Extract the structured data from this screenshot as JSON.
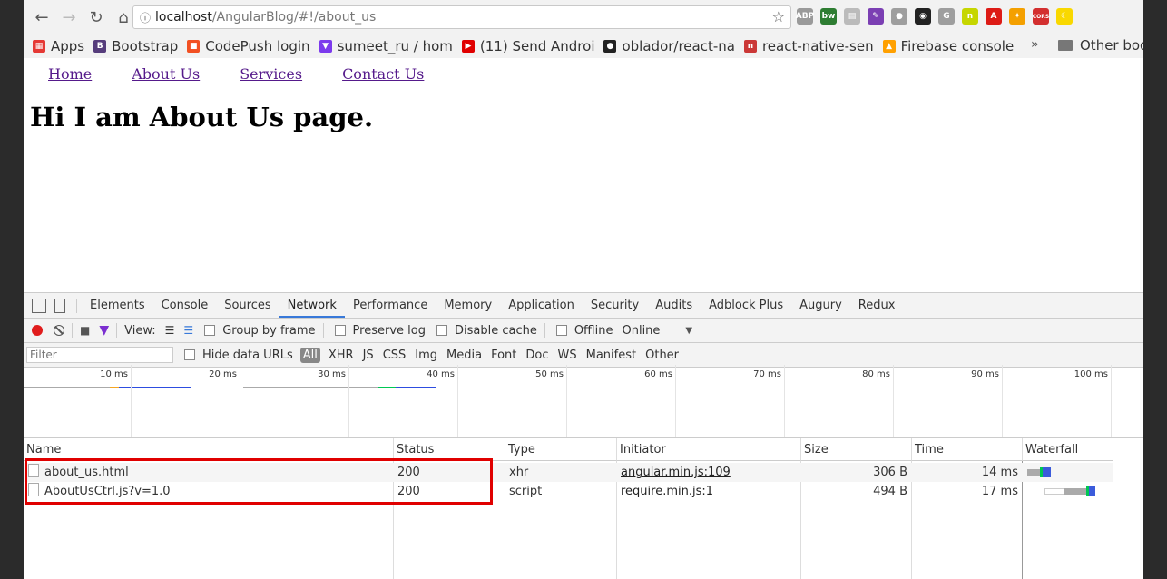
{
  "browser": {
    "url_host": "localhost",
    "url_path": "/AngularBlog/#!/about_us",
    "extensions": [
      {
        "name": "adblock-plus-icon",
        "label": "ABP",
        "color": "#9a9a9a"
      },
      {
        "name": "bw-icon",
        "label": "bw",
        "color": "#2e7d32"
      },
      {
        "name": "reader-icon",
        "label": "▤",
        "color": "#bbbbbb"
      },
      {
        "name": "eyedropper-icon",
        "label": "✎",
        "color": "#7b3fb3"
      },
      {
        "name": "chat-icon",
        "label": "●",
        "color": "#9e9e9e"
      },
      {
        "name": "dark-circle-icon",
        "label": "◉",
        "color": "#222222"
      },
      {
        "name": "g-icon",
        "label": "G",
        "color": "#9e9e9e"
      },
      {
        "name": "yellow-n-icon",
        "label": "n",
        "color": "#c6d600"
      },
      {
        "name": "angular-icon",
        "label": "A",
        "color": "#dd1b16"
      },
      {
        "name": "augury-icon",
        "label": "✦",
        "color": "#f4a000"
      },
      {
        "name": "cors-icon",
        "label": "CORS",
        "color": "#d32f2f"
      },
      {
        "name": "moon-icon",
        "label": "☾",
        "color": "#f9d800"
      }
    ]
  },
  "bookmarks": [
    {
      "name": "apps",
      "label": "Apps",
      "color": "#e53935",
      "icon": "▦"
    },
    {
      "name": "bootstrap",
      "label": "Bootstrap",
      "color": "#563d7c",
      "icon": "B"
    },
    {
      "name": "codepush",
      "label": "CodePush login",
      "color": "#f25022",
      "icon": "■"
    },
    {
      "name": "sumeet",
      "label": "sumeet_ru / hom",
      "color": "#7c3aed",
      "icon": "▼"
    },
    {
      "name": "youtube",
      "label": "(11) Send Androi",
      "color": "#e00000",
      "icon": "▶"
    },
    {
      "name": "github",
      "label": "oblador/react-na",
      "color": "#222222",
      "icon": "●"
    },
    {
      "name": "npm",
      "label": "react-native-sen",
      "color": "#cb3837",
      "icon": "n"
    },
    {
      "name": "firebase",
      "label": "Firebase console",
      "color": "#ffa000",
      "icon": "▲"
    }
  ],
  "bookmarks_more": "»",
  "bookmarks_other": "Other boo",
  "page": {
    "nav": [
      "Home",
      "About Us",
      "Services",
      "Contact Us"
    ],
    "heading": "Hi I am About Us page."
  },
  "devtools": {
    "tabs": [
      "Elements",
      "Console",
      "Sources",
      "Network",
      "Performance",
      "Memory",
      "Application",
      "Security",
      "Audits",
      "Adblock Plus",
      "Augury",
      "Redux"
    ],
    "active_tab": "Network",
    "view_label": "View:",
    "group_by_frame": "Group by frame",
    "preserve_log": "Preserve log",
    "disable_cache": "Disable cache",
    "offline": "Offline",
    "throttle": "Online",
    "filter_placeholder": "Filter",
    "hide_data_urls": "Hide data URLs",
    "filter_types": [
      "All",
      "XHR",
      "JS",
      "CSS",
      "Img",
      "Media",
      "Font",
      "Doc",
      "WS",
      "Manifest",
      "Other"
    ],
    "ticks": [
      "10 ms",
      "20 ms",
      "30 ms",
      "40 ms",
      "50 ms",
      "60 ms",
      "70 ms",
      "80 ms",
      "90 ms",
      "100 ms"
    ],
    "columns": [
      "Name",
      "Status",
      "Type",
      "Initiator",
      "Size",
      "Time",
      "Waterfall"
    ],
    "rows": [
      {
        "name": "about_us.html",
        "status": "200",
        "type": "xhr",
        "initiator": "angular.min.js:109",
        "size": "306 B",
        "time": "14 ms"
      },
      {
        "name": "AboutUsCtrl.js?v=1.0",
        "status": "200",
        "type": "script",
        "initiator": "require.min.js:1",
        "size": "494 B",
        "time": "17 ms"
      }
    ]
  }
}
